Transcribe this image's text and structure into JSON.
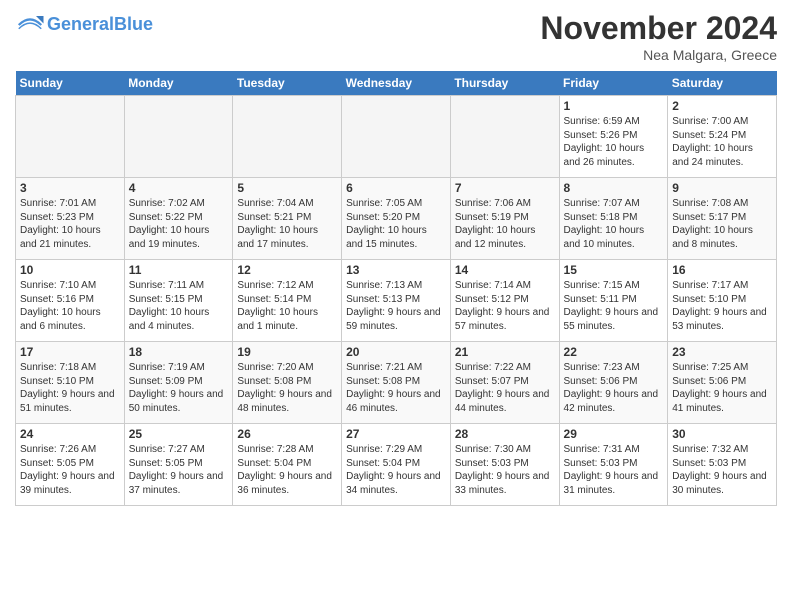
{
  "header": {
    "logo_line1": "General",
    "logo_line2": "Blue",
    "month": "November 2024",
    "location": "Nea Malgara, Greece"
  },
  "days_of_week": [
    "Sunday",
    "Monday",
    "Tuesday",
    "Wednesday",
    "Thursday",
    "Friday",
    "Saturday"
  ],
  "weeks": [
    [
      {
        "num": "",
        "info": ""
      },
      {
        "num": "",
        "info": ""
      },
      {
        "num": "",
        "info": ""
      },
      {
        "num": "",
        "info": ""
      },
      {
        "num": "",
        "info": ""
      },
      {
        "num": "1",
        "info": "Sunrise: 6:59 AM\nSunset: 5:26 PM\nDaylight: 10 hours and 26 minutes."
      },
      {
        "num": "2",
        "info": "Sunrise: 7:00 AM\nSunset: 5:24 PM\nDaylight: 10 hours and 24 minutes."
      }
    ],
    [
      {
        "num": "3",
        "info": "Sunrise: 7:01 AM\nSunset: 5:23 PM\nDaylight: 10 hours and 21 minutes."
      },
      {
        "num": "4",
        "info": "Sunrise: 7:02 AM\nSunset: 5:22 PM\nDaylight: 10 hours and 19 minutes."
      },
      {
        "num": "5",
        "info": "Sunrise: 7:04 AM\nSunset: 5:21 PM\nDaylight: 10 hours and 17 minutes."
      },
      {
        "num": "6",
        "info": "Sunrise: 7:05 AM\nSunset: 5:20 PM\nDaylight: 10 hours and 15 minutes."
      },
      {
        "num": "7",
        "info": "Sunrise: 7:06 AM\nSunset: 5:19 PM\nDaylight: 10 hours and 12 minutes."
      },
      {
        "num": "8",
        "info": "Sunrise: 7:07 AM\nSunset: 5:18 PM\nDaylight: 10 hours and 10 minutes."
      },
      {
        "num": "9",
        "info": "Sunrise: 7:08 AM\nSunset: 5:17 PM\nDaylight: 10 hours and 8 minutes."
      }
    ],
    [
      {
        "num": "10",
        "info": "Sunrise: 7:10 AM\nSunset: 5:16 PM\nDaylight: 10 hours and 6 minutes."
      },
      {
        "num": "11",
        "info": "Sunrise: 7:11 AM\nSunset: 5:15 PM\nDaylight: 10 hours and 4 minutes."
      },
      {
        "num": "12",
        "info": "Sunrise: 7:12 AM\nSunset: 5:14 PM\nDaylight: 10 hours and 1 minute."
      },
      {
        "num": "13",
        "info": "Sunrise: 7:13 AM\nSunset: 5:13 PM\nDaylight: 9 hours and 59 minutes."
      },
      {
        "num": "14",
        "info": "Sunrise: 7:14 AM\nSunset: 5:12 PM\nDaylight: 9 hours and 57 minutes."
      },
      {
        "num": "15",
        "info": "Sunrise: 7:15 AM\nSunset: 5:11 PM\nDaylight: 9 hours and 55 minutes."
      },
      {
        "num": "16",
        "info": "Sunrise: 7:17 AM\nSunset: 5:10 PM\nDaylight: 9 hours and 53 minutes."
      }
    ],
    [
      {
        "num": "17",
        "info": "Sunrise: 7:18 AM\nSunset: 5:10 PM\nDaylight: 9 hours and 51 minutes."
      },
      {
        "num": "18",
        "info": "Sunrise: 7:19 AM\nSunset: 5:09 PM\nDaylight: 9 hours and 50 minutes."
      },
      {
        "num": "19",
        "info": "Sunrise: 7:20 AM\nSunset: 5:08 PM\nDaylight: 9 hours and 48 minutes."
      },
      {
        "num": "20",
        "info": "Sunrise: 7:21 AM\nSunset: 5:08 PM\nDaylight: 9 hours and 46 minutes."
      },
      {
        "num": "21",
        "info": "Sunrise: 7:22 AM\nSunset: 5:07 PM\nDaylight: 9 hours and 44 minutes."
      },
      {
        "num": "22",
        "info": "Sunrise: 7:23 AM\nSunset: 5:06 PM\nDaylight: 9 hours and 42 minutes."
      },
      {
        "num": "23",
        "info": "Sunrise: 7:25 AM\nSunset: 5:06 PM\nDaylight: 9 hours and 41 minutes."
      }
    ],
    [
      {
        "num": "24",
        "info": "Sunrise: 7:26 AM\nSunset: 5:05 PM\nDaylight: 9 hours and 39 minutes."
      },
      {
        "num": "25",
        "info": "Sunrise: 7:27 AM\nSunset: 5:05 PM\nDaylight: 9 hours and 37 minutes."
      },
      {
        "num": "26",
        "info": "Sunrise: 7:28 AM\nSunset: 5:04 PM\nDaylight: 9 hours and 36 minutes."
      },
      {
        "num": "27",
        "info": "Sunrise: 7:29 AM\nSunset: 5:04 PM\nDaylight: 9 hours and 34 minutes."
      },
      {
        "num": "28",
        "info": "Sunrise: 7:30 AM\nSunset: 5:03 PM\nDaylight: 9 hours and 33 minutes."
      },
      {
        "num": "29",
        "info": "Sunrise: 7:31 AM\nSunset: 5:03 PM\nDaylight: 9 hours and 31 minutes."
      },
      {
        "num": "30",
        "info": "Sunrise: 7:32 AM\nSunset: 5:03 PM\nDaylight: 9 hours and 30 minutes."
      }
    ]
  ]
}
